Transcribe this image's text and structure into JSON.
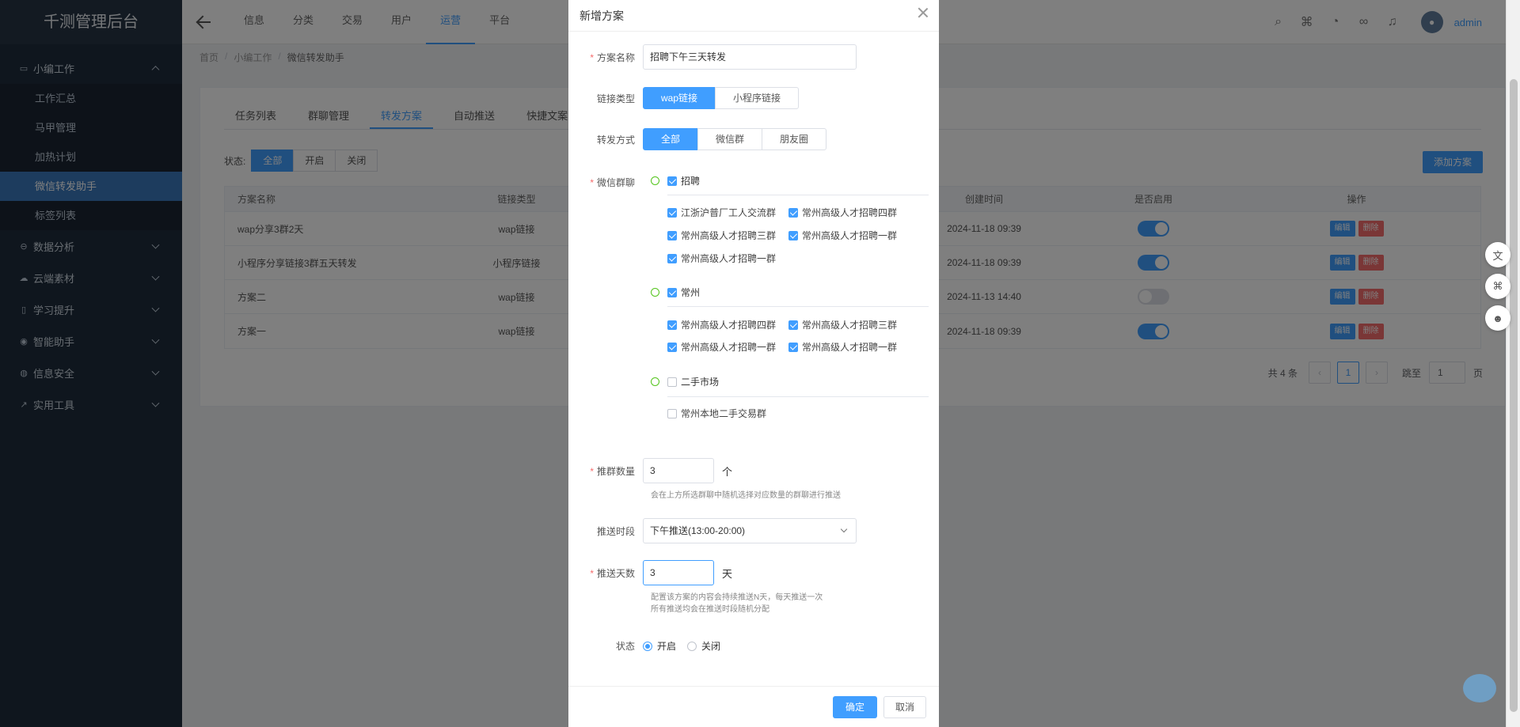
{
  "app": {
    "title": "千测管理后台",
    "user": "admin"
  },
  "sidebar": {
    "groups": [
      {
        "label": "小编工作",
        "icon": "briefcase-icon",
        "expanded": true,
        "items": [
          "工作汇总",
          "马甲管理",
          "加热计划",
          "微信转发助手",
          "标签列表"
        ],
        "active_index": 3
      },
      {
        "label": "数据分析",
        "icon": "chart-icon"
      },
      {
        "label": "云端素材",
        "icon": "cloud-icon"
      },
      {
        "label": "学习提升",
        "icon": "book-icon"
      },
      {
        "label": "智能助手",
        "icon": "robot-icon"
      },
      {
        "label": "信息安全",
        "icon": "shield-icon"
      },
      {
        "label": "实用工具",
        "icon": "wrench-icon"
      }
    ]
  },
  "topnav": {
    "items": [
      "信息",
      "分类",
      "交易",
      "用户",
      "运营",
      "平台"
    ],
    "active_index": 4
  },
  "breadcrumb": [
    "首页",
    "小编工作",
    "微信转发助手"
  ],
  "page": {
    "tabs": [
      "任务列表",
      "群聊管理",
      "转发方案",
      "自动推送",
      "快捷文案"
    ],
    "active_tab": 2,
    "status_label": "状态:",
    "status_filters": [
      "全部",
      "开启",
      "关闭"
    ],
    "add_button": "添加方案",
    "table": {
      "headers": [
        "方案名称",
        "链接类型",
        "创建时间",
        "是否启用",
        "操作"
      ],
      "rows": [
        {
          "name": "wap分享3群2天",
          "type": "wap链接",
          "created": "2024-11-18 09:39",
          "enabled": true
        },
        {
          "name": "小程序分享链接3群五天转发",
          "type": "小程序链接",
          "created": "2024-11-18 09:39",
          "enabled": true
        },
        {
          "name": "方案二",
          "type": "wap链接",
          "created": "2024-11-13 14:40",
          "enabled": false
        },
        {
          "name": "方案一",
          "type": "wap链接",
          "created": "2024-11-18 09:39",
          "enabled": true
        }
      ],
      "edit_label": "编辑",
      "delete_label": "删除"
    },
    "pager": {
      "total": "共 4 条",
      "current": "1",
      "jump_label": "跳至",
      "jump_value": "1",
      "page_unit": "页"
    }
  },
  "dialog": {
    "title": "新增方案",
    "name_label": "方案名称",
    "name_value": "招聘下午三天转发",
    "link_type_label": "链接类型",
    "link_types": [
      "wap链接",
      "小程序链接"
    ],
    "forward_label": "转发方式",
    "forward_modes": [
      "全部",
      "微信群",
      "朋友圈"
    ],
    "groups_label": "微信群聊",
    "tree": [
      {
        "name": "招聘",
        "checked": true,
        "children": [
          {
            "name": "江浙沪普厂工人交流群",
            "checked": true
          },
          {
            "name": "常州高级人才招聘四群",
            "checked": true
          },
          {
            "name": "常州高级人才招聘三群",
            "checked": true
          },
          {
            "name": "常州高级人才招聘一群",
            "checked": true
          },
          {
            "name": "常州高级人才招聘一群",
            "checked": true
          }
        ]
      },
      {
        "name": "常州",
        "checked": true,
        "children": [
          {
            "name": "常州高级人才招聘四群",
            "checked": true
          },
          {
            "name": "常州高级人才招聘三群",
            "checked": true
          },
          {
            "name": "常州高级人才招聘一群",
            "checked": true
          },
          {
            "name": "常州高级人才招聘一群",
            "checked": true
          }
        ]
      },
      {
        "name": "二手市场",
        "checked": false,
        "children": [
          {
            "name": "常州本地二手交易群",
            "checked": false
          }
        ]
      }
    ],
    "push_count_label": "推群数量",
    "push_count_value": "3",
    "push_count_unit": "个",
    "push_count_hint": "会在上方所选群聊中随机选择对应数量的群聊进行推送",
    "push_period_label": "推送时段",
    "push_period_value": "下午推送(13:00-20:00)",
    "push_days_label": "推送天数",
    "push_days_value": "3",
    "push_days_unit": "天",
    "push_days_hint1": "配置该方案的内容会持续推送N天，每天推送一次",
    "push_days_hint2": "所有推送均会在推送时段随机分配",
    "status_label": "状态",
    "status_on": "开启",
    "status_off": "关闭",
    "ok": "确定",
    "cancel": "取消"
  }
}
